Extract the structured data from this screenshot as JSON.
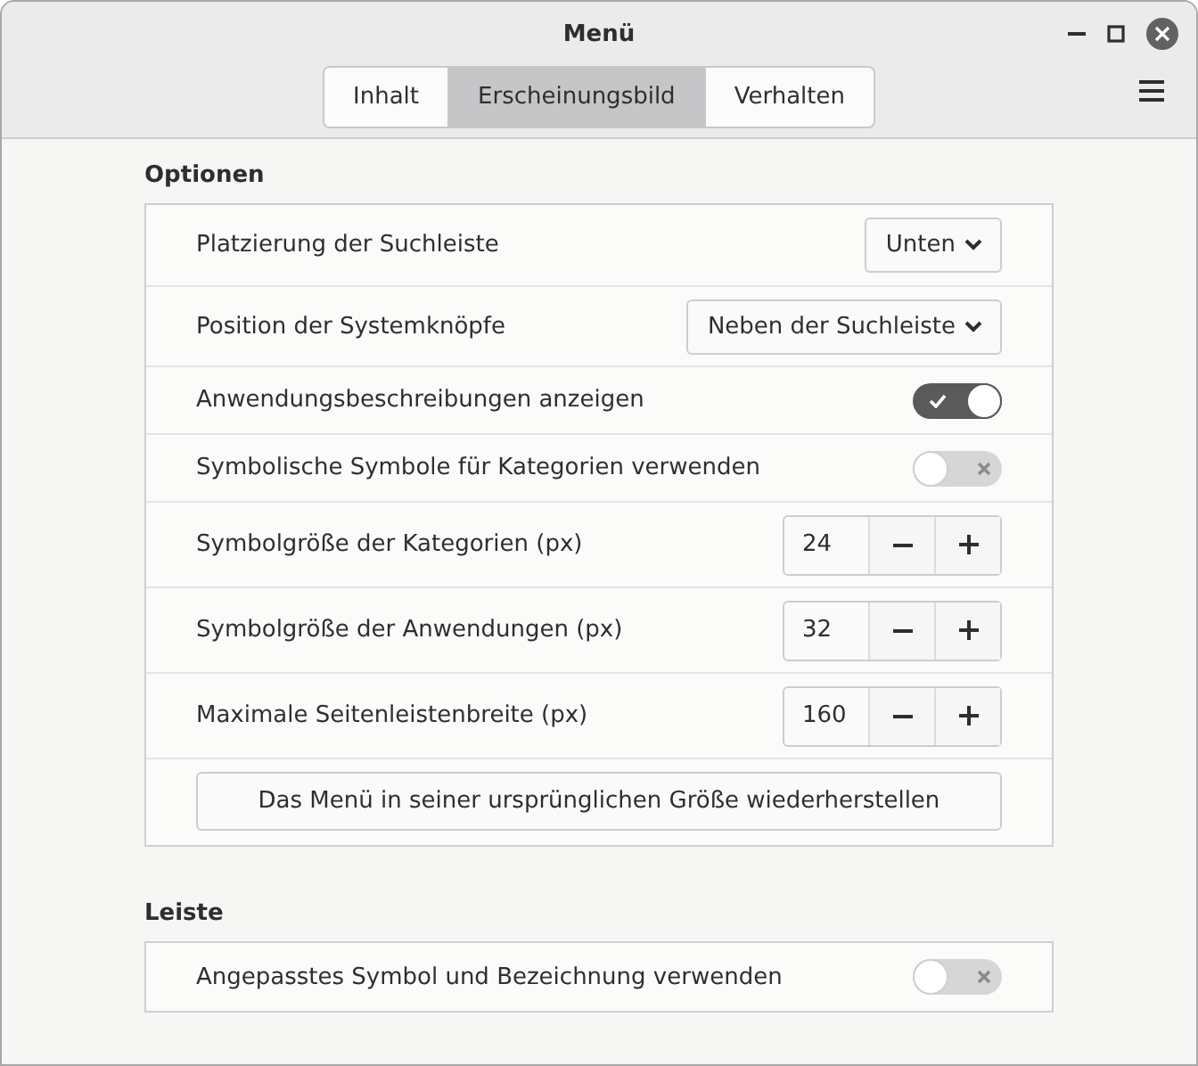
{
  "window": {
    "title": "Menü"
  },
  "tabs": [
    {
      "label": "Inhalt",
      "selected": false
    },
    {
      "label": "Erscheinungsbild",
      "selected": true
    },
    {
      "label": "Verhalten",
      "selected": false
    }
  ],
  "sections": [
    {
      "title": "Optionen",
      "rows": [
        {
          "kind": "dropdown",
          "label": "Platzierung der Suchleiste",
          "value": "Unten"
        },
        {
          "kind": "dropdown",
          "label": "Position der Systemknöpfe",
          "value": "Neben der Suchleiste"
        },
        {
          "kind": "switch",
          "label": "Anwendungsbeschreibungen anzeigen",
          "on": true
        },
        {
          "kind": "switch",
          "label": "Symbolische Symbole für Kategorien verwenden",
          "on": false
        },
        {
          "kind": "spin",
          "label": "Symbolgröße der Kategorien (px)",
          "value": "24"
        },
        {
          "kind": "spin",
          "label": "Symbolgröße der Anwendungen (px)",
          "value": "32"
        },
        {
          "kind": "spin",
          "label": "Maximale Seitenleistenbreite (px)",
          "value": "160"
        },
        {
          "kind": "button",
          "label": "Das Menü in seiner ursprünglichen Größe wiederherstellen"
        }
      ]
    },
    {
      "title": "Leiste",
      "rows": [
        {
          "kind": "switch",
          "label": "Angepasstes Symbol und Bezeichnung verwenden",
          "on": false
        }
      ]
    }
  ]
}
